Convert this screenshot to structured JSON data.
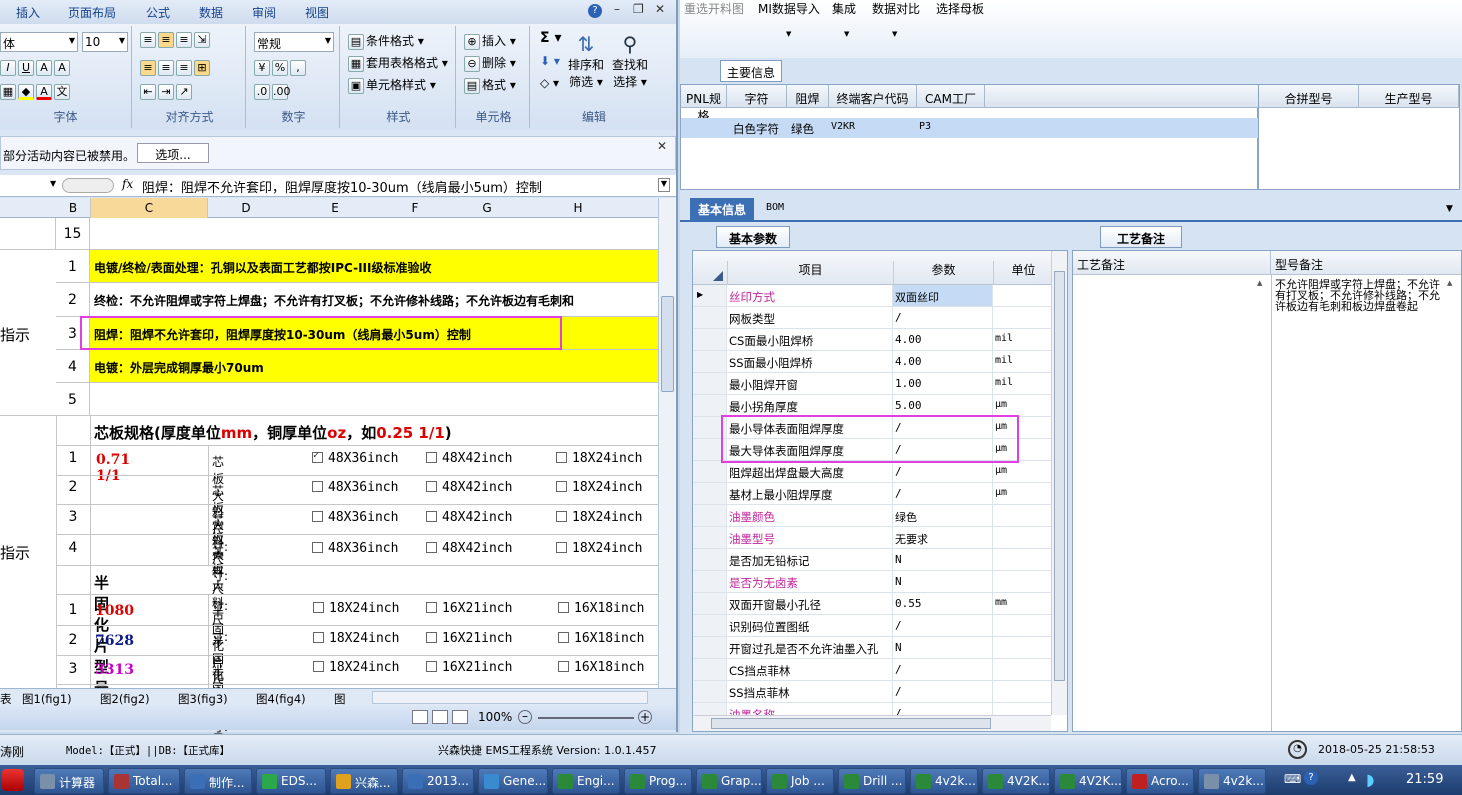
{
  "excel": {
    "tabs": [
      "插入",
      "页面布局",
      "公式",
      "数据",
      "审阅",
      "视图"
    ],
    "font_name": "体",
    "font_size": "10",
    "style_value": "常规",
    "cond_format": "条件格式 ▾",
    "table_format": "套用表格格式 ▾",
    "cell_style": "单元格样式 ▾",
    "insert": "插入 ▾",
    "delete": "删除 ▾",
    "format": "格式 ▾",
    "sort_filter_1": "排序和",
    "sort_filter_2": "筛选 ▾",
    "find_select_1": "查找和",
    "find_select_2": "选择 ▾",
    "groups": [
      "字体",
      "对齐方式",
      "数字",
      "样式",
      "单元格",
      "编辑"
    ],
    "security_msg": "部分活动内容已被禁用。",
    "options_btn": "选项...",
    "formula": "阻焊：阻焊不允许套印，阻焊厚度按10-30um（线肩最小5um）控制",
    "cols": [
      "B",
      "C",
      "D",
      "E",
      "F",
      "G",
      "H"
    ],
    "side_labels": [
      "指示",
      "指示"
    ],
    "rows": {
      "r15": "15",
      "n1": "1",
      "n2": "2",
      "n3": "3",
      "n4": "4",
      "n5": "5",
      "t1": "电镀/终检/表面处理：孔铜以及表面工艺都按IPC-III级标准验收",
      "t2": "终检：不允许阻焊或字符上焊盘；不允许有打叉板；不允许修补线路；不允许板边有毛刺和",
      "t3": "阻焊：阻焊不允许套印，阻焊厚度按10-30um（线肩最小5um）控制",
      "t4": "电镀：外层完成铜厚最小70um",
      "core_title": "芯板规格(厚度单位",
      "core_mm": "mm",
      "core_mid": "，铜厚单位",
      "core_oz": "oz",
      "core_tail": "，如",
      "core_eg": "0.25 1/1",
      "core_end": ")",
      "core_val": "0.71 1/1",
      "core_label": "芯板大料尺寸:",
      "c1": "48X36inch",
      "c2": "48X42inch",
      "c3": "18X24inch",
      "pp_title": "半固化片型号",
      "pp_label": "半固化片尺寸:",
      "p1": "18X24inch",
      "p2": "16X21inch",
      "p3": "16X18inch",
      "pp_vals": [
        "1080",
        "7628",
        "3313"
      ]
    },
    "sheet_tabs": [
      "表",
      "图1(fig1)",
      "图2(fig2)",
      "图3(fig3)",
      "图4(fig4)",
      "图"
    ],
    "zoom": "100%"
  },
  "app": {
    "menu": [
      "重选开料图",
      "MI数据导入",
      "集成",
      "数据对比",
      "选择母板"
    ],
    "main_info_tab": "主要信息",
    "grid_headers": [
      "PNL规格",
      "字符",
      "阻焊",
      "终端客户代码",
      "CAM工厂"
    ],
    "grid_row": [
      "白色字符",
      "绿色",
      "V2KR",
      "P3"
    ],
    "right_headers": [
      "合拼型号",
      "生产型号"
    ],
    "tabs2": [
      "基本信息",
      "BOM"
    ],
    "basic_params": "基本参数",
    "process_remarks": "工艺备注",
    "param_headers": [
      "项目",
      "参数",
      "单位"
    ],
    "params": [
      {
        "name": "丝印方式",
        "value": "双面丝印",
        "unit": "",
        "pink": true
      },
      {
        "name": "网板类型",
        "value": "/",
        "unit": "",
        "pink": false
      },
      {
        "name": "CS面最小阻焊桥",
        "value": "4.00",
        "unit": "mil",
        "pink": false
      },
      {
        "name": "SS面最小阻焊桥",
        "value": "4.00",
        "unit": "mil",
        "pink": false
      },
      {
        "name": "最小阻焊开窗",
        "value": "1.00",
        "unit": "mil",
        "pink": false
      },
      {
        "name": "最小拐角厚度",
        "value": "5.00",
        "unit": "μm",
        "pink": false
      },
      {
        "name": "最小导体表面阻焊厚度",
        "value": "/",
        "unit": "μm",
        "pink": false
      },
      {
        "name": "最大导体表面阻焊厚度",
        "value": "/",
        "unit": "μm",
        "pink": false
      },
      {
        "name": "阻焊超出焊盘最大高度",
        "value": "/",
        "unit": "μm",
        "pink": false
      },
      {
        "name": "基材上最小阻焊厚度",
        "value": "/",
        "unit": "μm",
        "pink": false
      },
      {
        "name": "油墨颜色",
        "value": "绿色",
        "unit": "",
        "pink": true
      },
      {
        "name": "油墨型号",
        "value": "无要求",
        "unit": "",
        "pink": true
      },
      {
        "name": "是否加无铅标记",
        "value": "N",
        "unit": "",
        "pink": false
      },
      {
        "name": "是否为无卤素",
        "value": "N",
        "unit": "",
        "pink": true
      },
      {
        "name": "双面开窗最小孔径",
        "value": "0.55",
        "unit": "mm",
        "pink": false
      },
      {
        "name": "识别码位置图纸",
        "value": "/",
        "unit": "",
        "pink": false
      },
      {
        "name": "开窗过孔是否不允许油墨入孔",
        "value": "N",
        "unit": "",
        "pink": false
      },
      {
        "name": "CS挡点菲林",
        "value": "/",
        "unit": "",
        "pink": false
      },
      {
        "name": "SS挡点菲林",
        "value": "/",
        "unit": "",
        "pink": false
      },
      {
        "name": "油墨名称",
        "value": "/",
        "unit": "",
        "pink": true
      }
    ],
    "remark_headers": [
      "工艺备注",
      "型号备注"
    ],
    "remark_text": "不允许阻焊或字符上焊盘；不允许有打叉板；不允许修补线路；不允许板边有毛刺和板边焊盘卷起",
    "status_user": "涛刚",
    "status_model": "Model:【正式】||DB:【正式库】",
    "status_sys": "兴森快捷 EMS工程系统 Version: 1.0.1.457",
    "status_time": "2018-05-25 21:58:53"
  },
  "taskbar": {
    "items": [
      "计算器",
      "Total...",
      "制作...",
      "EDS...",
      "兴森...",
      "2013...",
      "Gene...",
      "Engi...",
      "Prog...",
      "Grap...",
      "Job ...",
      "Drill ...",
      "4v2k...",
      "4V2K...",
      "4V2K...",
      "Acro...",
      "4v2k..."
    ],
    "clock": "21:59"
  }
}
